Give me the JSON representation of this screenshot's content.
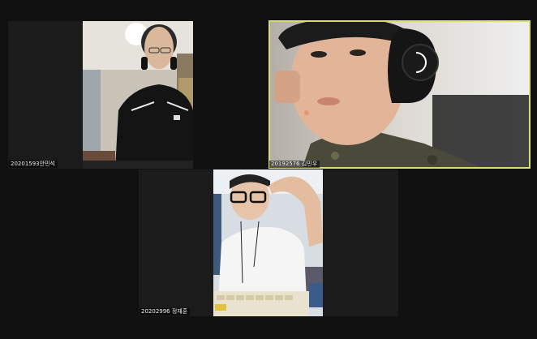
{
  "participants": [
    {
      "name_label": "20201593안민석"
    },
    {
      "name_label": "20192576 김민우"
    },
    {
      "name_label": "20202996 정재훈"
    }
  ]
}
